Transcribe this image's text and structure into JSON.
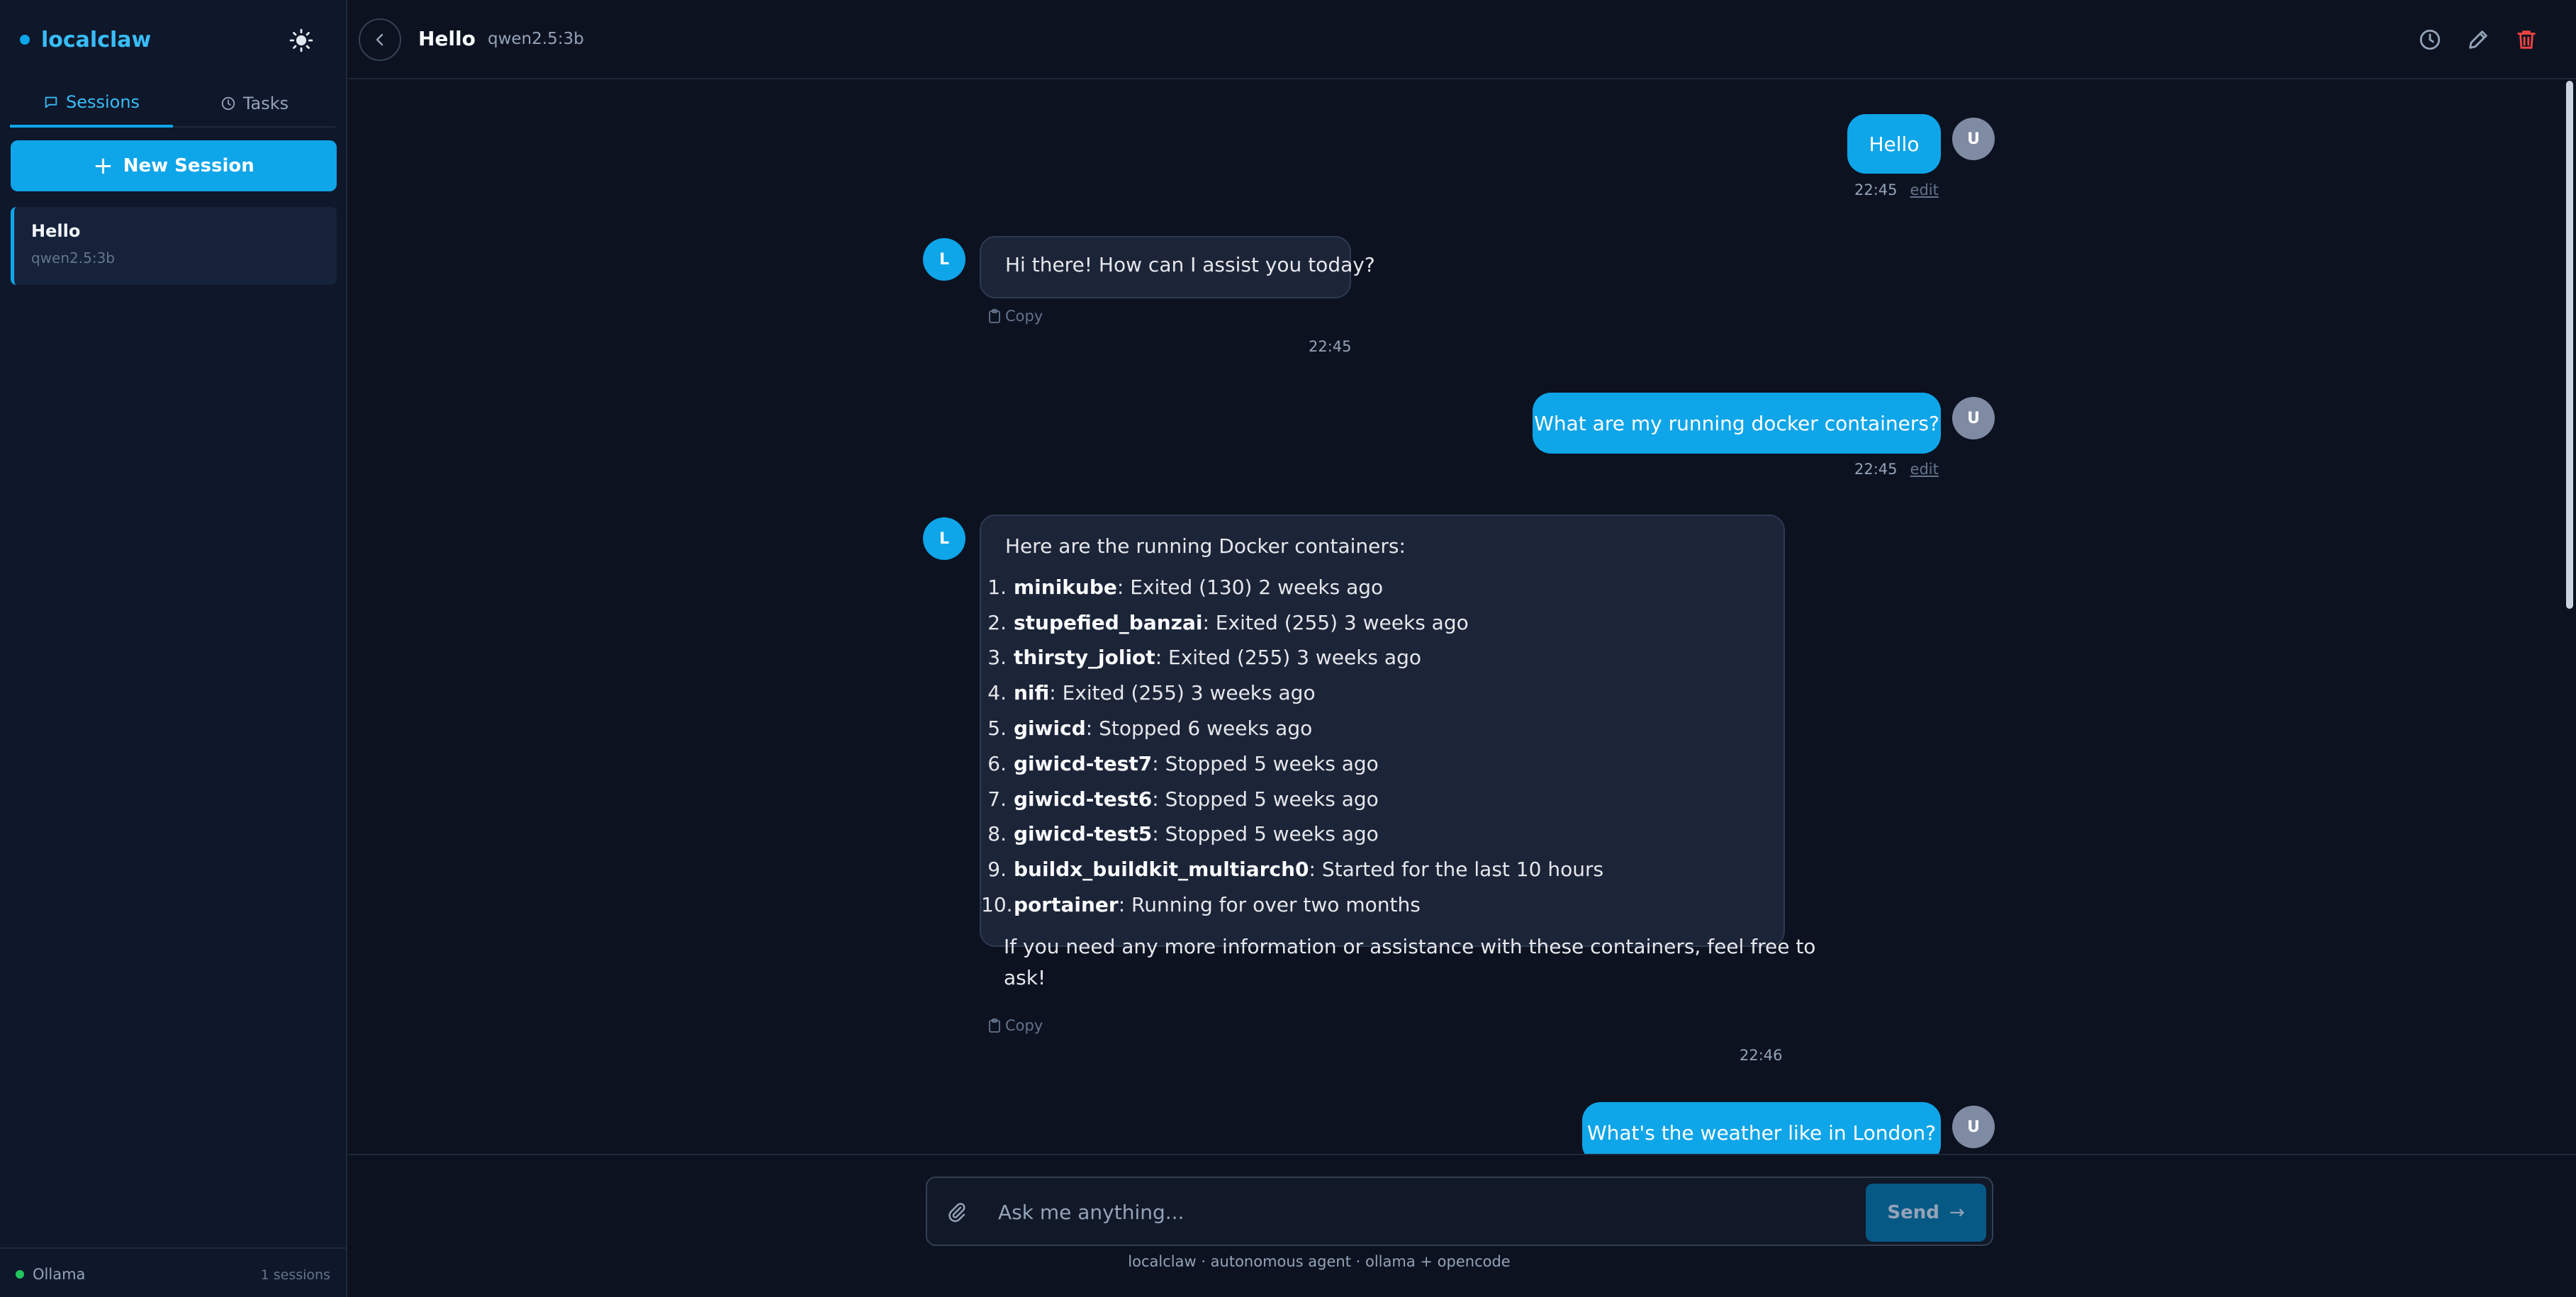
{
  "app": {
    "brand": "localclaw"
  },
  "sidebar": {
    "tabs": [
      {
        "label": "Sessions",
        "icon": "chat-bubble-icon",
        "active": true
      },
      {
        "label": "Tasks",
        "icon": "clock-icon",
        "active": false
      }
    ],
    "new_session_label": "New Session",
    "sessions": [
      {
        "title": "Hello",
        "model": "qwen2.5:3b"
      }
    ],
    "footer": {
      "provider": "Ollama",
      "session_count": "1 sessions"
    }
  },
  "header": {
    "title": "Hello",
    "model": "qwen2.5:3b"
  },
  "messages": [
    {
      "role": "user",
      "avatar": "U",
      "text": "Hello",
      "time": "22:45",
      "edit_label": "edit"
    },
    {
      "role": "assistant",
      "avatar": "L",
      "text": "Hi there! How can I assist you today?",
      "copy_label": "Copy",
      "time": "22:45"
    },
    {
      "role": "user",
      "avatar": "U",
      "text": "What are my running docker containers?",
      "time": "22:45",
      "edit_label": "edit"
    },
    {
      "role": "assistant",
      "avatar": "L",
      "intro": "Here are the running Docker containers:",
      "items": [
        {
          "num": "1.",
          "name": "minikube",
          "status": ": Exited (130) 2 weeks ago"
        },
        {
          "num": "2.",
          "name": "stupefied_banzai",
          "status": ": Exited (255) 3 weeks ago"
        },
        {
          "num": "3.",
          "name": "thirsty_joliot",
          "status": ": Exited (255) 3 weeks ago"
        },
        {
          "num": "4.",
          "name": "nifi",
          "status": ": Exited (255) 3 weeks ago"
        },
        {
          "num": "5.",
          "name": "giwicd",
          "status": ": Stopped 6 weeks ago"
        },
        {
          "num": "6.",
          "name": "giwicd-test7",
          "status": ": Stopped 5 weeks ago"
        },
        {
          "num": "7.",
          "name": "giwicd-test6",
          "status": ": Stopped 5 weeks ago"
        },
        {
          "num": "8.",
          "name": "giwicd-test5",
          "status": ": Stopped 5 weeks ago"
        },
        {
          "num": "9.",
          "name": "buildx_buildkit_multiarch0",
          "status": ": Started for the last 10 hours"
        },
        {
          "num": "10.",
          "name": "portainer",
          "status": ": Running for over two months"
        }
      ],
      "outro_line1": "If you need any more information or assistance with these containers, feel free to",
      "outro_line2": "ask!",
      "copy_label": "Copy",
      "time": "22:46"
    },
    {
      "role": "user",
      "avatar": "U",
      "text": "What's the weather like in London?"
    }
  ],
  "composer": {
    "placeholder": "Ask me anything...",
    "send_label": "Send",
    "send_arrow": "→",
    "footnote": "localclaw · autonomous agent · ollama + opencode"
  },
  "colors": {
    "accent": "#0ea5e9",
    "background": "#0c1220",
    "panel": "#0f172a",
    "danger": "#ef4444",
    "online": "#22c55e"
  }
}
